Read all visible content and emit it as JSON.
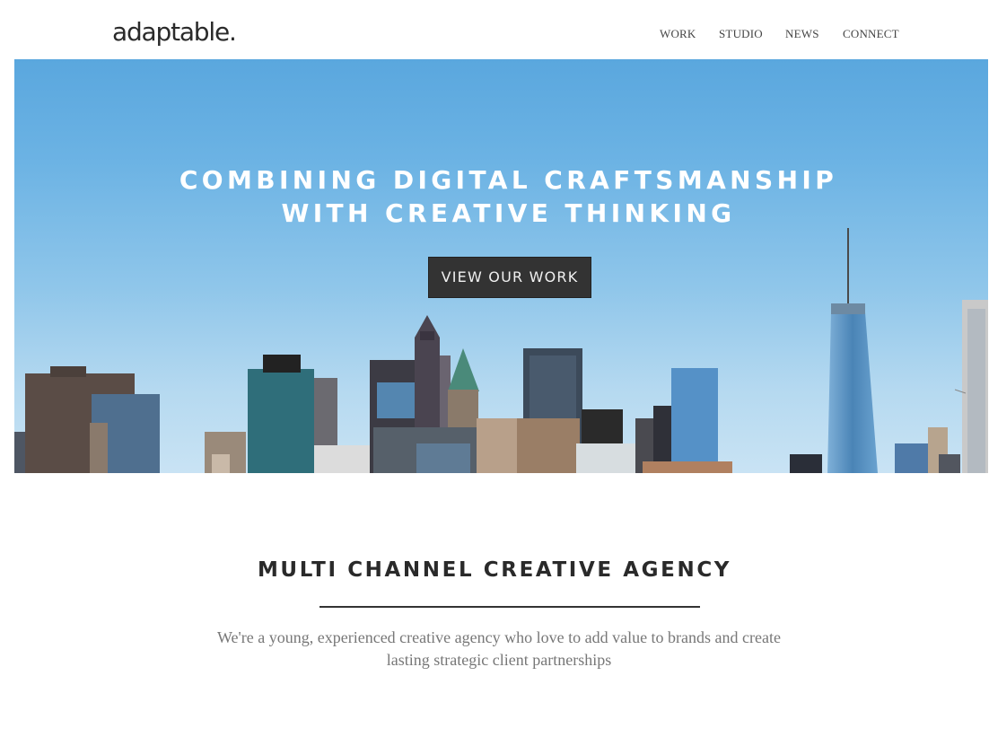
{
  "header": {
    "logo": "adaptable.",
    "nav": [
      {
        "label": "WORK"
      },
      {
        "label": "STUDIO"
      },
      {
        "label": "NEWS"
      },
      {
        "label": "CONNECT"
      }
    ]
  },
  "hero": {
    "headline_line1": "COMBINING DIGITAL CRAFTSMANSHIP",
    "headline_line2": "WITH CREATIVE THINKING",
    "cta_label": "VIEW OUR WORK",
    "image": "city-skyline"
  },
  "about": {
    "title": "MULTI CHANNEL CREATIVE AGENCY",
    "text": "We're a young, experienced creative agency who love to add value to brands and create lasting strategic client partnerships"
  },
  "colors": {
    "sky": "#6cb3e4",
    "button_bg": "#333333",
    "text_dark": "#2a2a2a",
    "text_muted": "#777777"
  }
}
